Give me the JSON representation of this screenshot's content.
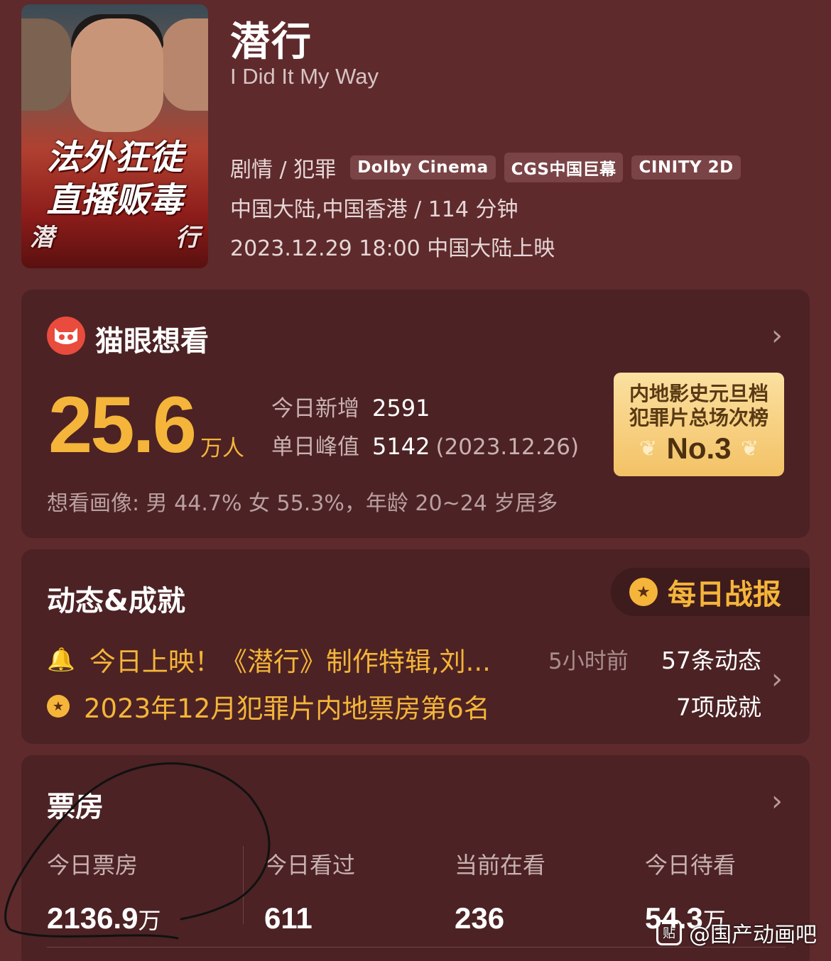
{
  "poster": {
    "line1": "法外狂徒",
    "line2": "直播贩毒",
    "brand_left": "潜",
    "brand_right": "行"
  },
  "movie": {
    "title": "潜行",
    "english_title": "I Did It My Way",
    "genre": "剧情 / 犯罪",
    "tags": [
      "Dolby Cinema",
      "CGS中国巨幕",
      "CINITY 2D"
    ],
    "region_duration": "中国大陆,中国香港 / 114 分钟",
    "release": "2023.12.29 18:00 中国大陆上映"
  },
  "want": {
    "title": "猫眼想看",
    "count": "25.6",
    "count_unit": "万人",
    "today_label": "今日新增",
    "today_value": "2591",
    "peak_label": "单日峰值",
    "peak_value": "5142",
    "peak_date": "(2023.12.26)",
    "portrait": "想看画像: 男 44.7%  女 55.3%，年龄 20~24 岁居多",
    "rank_line1": "内地影史元旦档",
    "rank_line2": "犯罪片总场次榜",
    "rank_no": "No.3"
  },
  "news": {
    "title": "动态&成就",
    "daily_report": "每日战报",
    "item1_text": "今日上映！《潜行》制作特辑,刘...",
    "item1_time": "5小时前",
    "item1_count": "57条动态",
    "item2_text": "2023年12月犯罪片内地票房第6名",
    "item2_count": "7项成就"
  },
  "box_office": {
    "title": "票房",
    "columns": [
      {
        "label": "今日票房",
        "value": "2136.9",
        "unit": "万"
      },
      {
        "label": "今日看过",
        "value": "611",
        "unit": ""
      },
      {
        "label": "当前在看",
        "value": "236",
        "unit": ""
      },
      {
        "label": "今日待看",
        "value": "54.3",
        "unit": "万"
      }
    ]
  },
  "watermark": {
    "icon_text": "贴",
    "text": "@国产动画吧"
  },
  "colors": {
    "background": "#5e2a2c",
    "card": "#4c2224",
    "accent": "#f4b53a",
    "logo_red": "#e94b3c"
  }
}
